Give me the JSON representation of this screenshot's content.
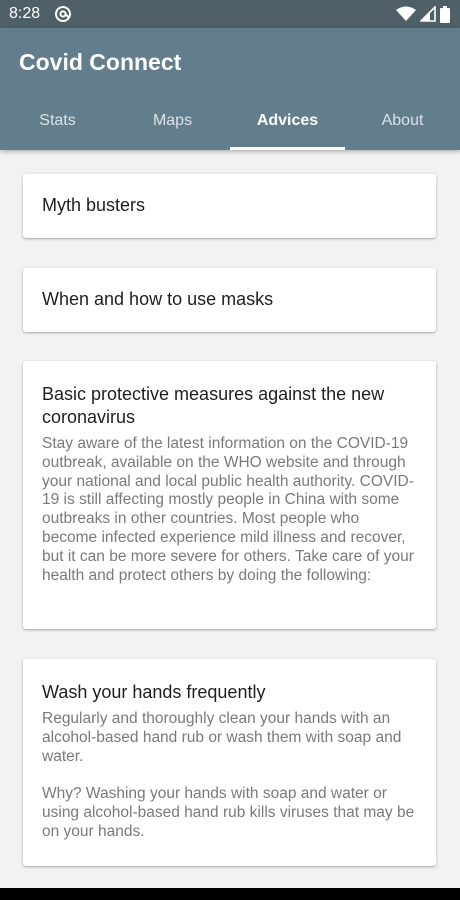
{
  "status_bar": {
    "time": "8:28"
  },
  "app": {
    "title": "Covid Connect"
  },
  "tabs": [
    {
      "label": "Stats"
    },
    {
      "label": "Maps"
    },
    {
      "label": "Advices"
    },
    {
      "label": "About"
    }
  ],
  "cards": [
    {
      "title": "Myth busters"
    },
    {
      "title": "When and how to use masks"
    },
    {
      "title": "Basic protective measures against the new coronavirus",
      "body": "Stay aware of the latest information on the COVID-19 outbreak, available on the WHO website and through your national and local public health authority. COVID-19 is still affecting mostly people in China with some outbreaks in other countries. Most people who become infected experience mild illness and recover, but it can be more severe for others. Take care of your health and protect others by doing the following:"
    },
    {
      "title": "Wash your hands frequently",
      "body": "Regularly and thoroughly clean your hands with an alcohol-based hand rub or wash them with soap and water.\n\nWhy? Washing your hands with soap and water or using alcohol-based hand rub kills viruses that may be on your hands."
    }
  ]
}
